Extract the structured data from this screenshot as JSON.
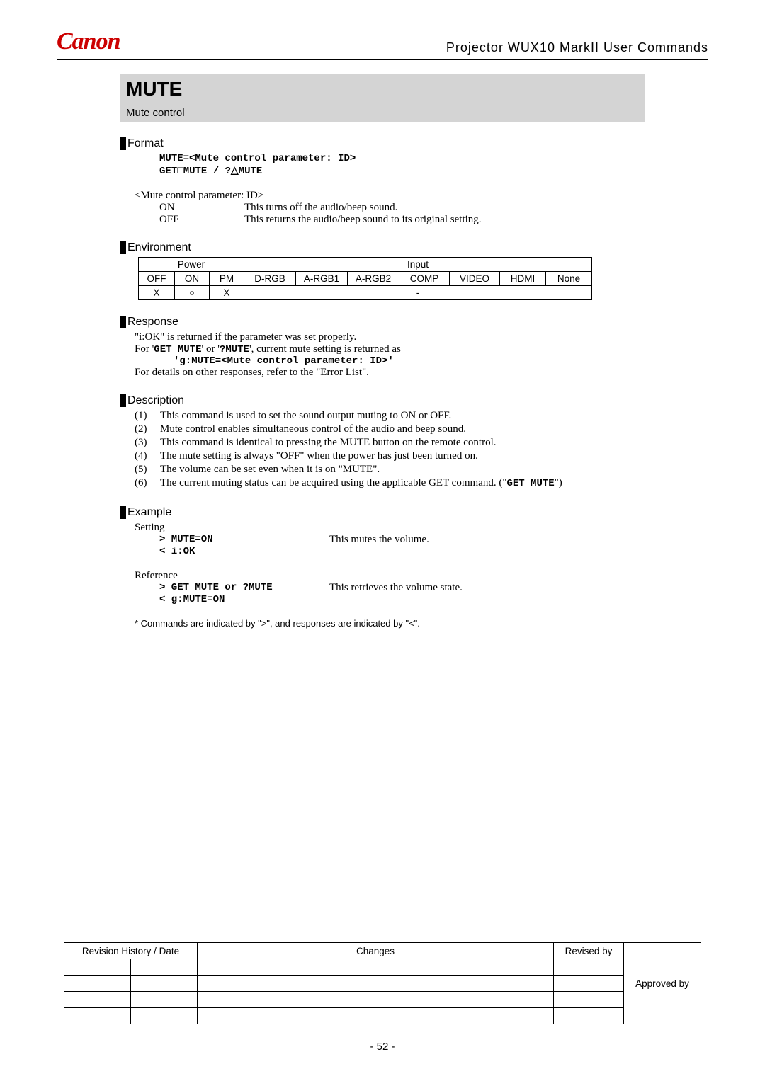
{
  "header": {
    "logo": "Canon",
    "doc_title": "Projector WUX10 MarkII User Commands"
  },
  "command": {
    "title": "MUTE",
    "subtitle": "Mute control"
  },
  "sections": {
    "format": {
      "label": "Format",
      "line1_a": "MUTE=<Mute control parameter: ID>",
      "line2_a": "GET",
      "line2_sq": "□",
      "line2_b": "MUTE",
      "line2_sep": "   /   ?",
      "line2_tri": "△",
      "line2_c": "MUTE",
      "param_header": "<Mute control parameter: ID>",
      "params": [
        {
          "key": "ON",
          "val": "This turns off the audio/beep sound."
        },
        {
          "key": "OFF",
          "val": "This returns the audio/beep sound to its original setting."
        }
      ]
    },
    "environment": {
      "label": "Environment",
      "groups": {
        "power": "Power",
        "input": "Input"
      },
      "power_cols": [
        "OFF",
        "ON",
        "PM"
      ],
      "input_cols": [
        "D-RGB",
        "A-RGB1",
        "A-RGB2",
        "COMP",
        "VIDEO",
        "HDMI",
        "None"
      ],
      "row": {
        "off": "X",
        "on": "○",
        "pm": "X",
        "input_dash": "-"
      }
    },
    "response": {
      "label": "Response",
      "line1": "\"i:OK\" is returned if the parameter was set properly.",
      "line2_a": "For '",
      "line2_b": "GET MUTE",
      "line2_c": "' or '",
      "line2_d": "?MUTE",
      "line2_e": "', current mute setting is returned as",
      "code": "'g:MUTE=<Mute control parameter: ID>'",
      "line3": "For details on other responses, refer to the \"Error List\"."
    },
    "description": {
      "label": "Description",
      "items": [
        "This command is used to set the sound output muting to ON or OFF.",
        "Mute control enables simultaneous control of the audio and beep sound.",
        "This command is identical to pressing the MUTE button on the remote control.",
        "The mute setting is always \"OFF\" when the power has just been turned on.",
        "The volume can be set even when it is on \"MUTE\".",
        "__special__"
      ],
      "item6_a": "The current muting status can be acquired using the applicable GET command. (\"",
      "item6_b": "GET MUTE",
      "item6_c": "\")"
    },
    "example": {
      "label": "Example",
      "setting_h": "Setting",
      "set1_cmd": "> MUTE=ON",
      "set1_desc": "This mutes the volume.",
      "set2_cmd": "< i:OK",
      "ref_h": "Reference",
      "ref1_cmd": "> GET MUTE or ?MUTE",
      "ref1_desc": "This retrieves the volume state.",
      "ref2_cmd": "< g:MUTE=ON",
      "footnote": "* Commands are indicated by \">\", and responses are indicated by \"<\"."
    }
  },
  "rev_table": {
    "h1": "Revision History / Date",
    "h2": "Changes",
    "h3": "Revised by",
    "h4": "Approved by"
  },
  "page_number": "- 52 -"
}
